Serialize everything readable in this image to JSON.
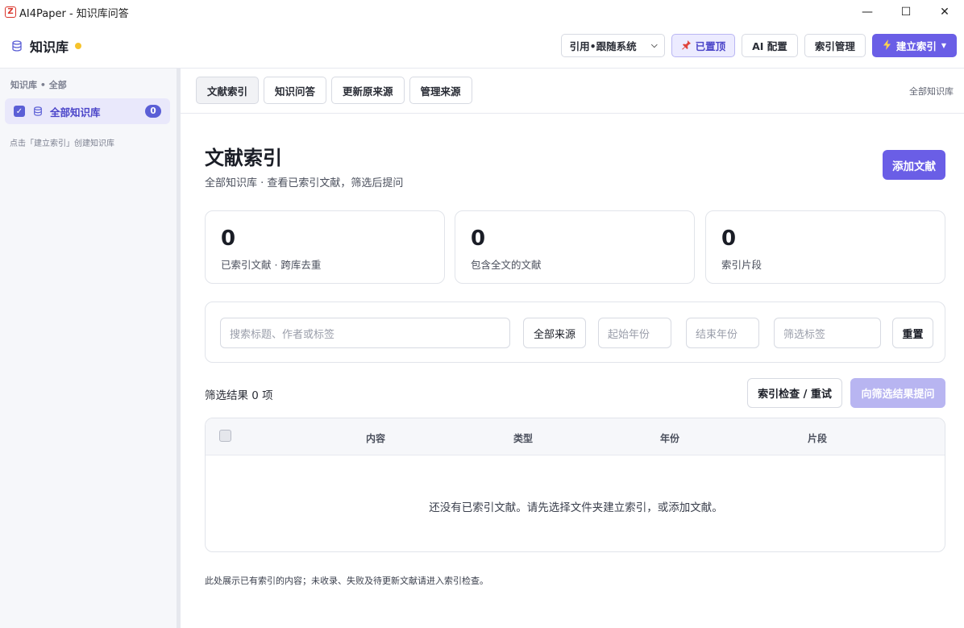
{
  "window": {
    "title": "AI4Paper - 知识库问答",
    "controls": {
      "minimize": "—",
      "maximize": "☐",
      "close": "✕"
    }
  },
  "header": {
    "title": "知识库",
    "status_dot_color": "#f6c32c",
    "mode_select": "引用•跟随系统",
    "pinned_label": "已置顶",
    "ai_config_label": "AI 配置",
    "index_manage_label": "索引管理",
    "build_index_label": "建立索引"
  },
  "sidebar": {
    "section_title": "知识库 • 全部",
    "items": [
      {
        "label": "全部知识库",
        "count": "0",
        "checked": true
      }
    ],
    "hint": "点击「建立索引」创建知识库"
  },
  "tabs": {
    "items": [
      {
        "label": "文献索引",
        "active": true
      },
      {
        "label": "知识问答",
        "active": false
      },
      {
        "label": "更新原来源",
        "active": false
      },
      {
        "label": "管理来源",
        "active": false
      }
    ],
    "scope": "全部知识库"
  },
  "main": {
    "title": "文献索引",
    "subtitle": "全部知识库 · 查看已索引文献，筛选后提问",
    "add_button": "添加文献",
    "stats": [
      {
        "value": "0",
        "label": "已索引文献 · 跨库去重"
      },
      {
        "value": "0",
        "label": "包含全文的文献"
      },
      {
        "value": "0",
        "label": "索引片段"
      }
    ],
    "filters": {
      "search_placeholder": "搜索标题、作者或标签",
      "source_button": "全部来源",
      "start_year_placeholder": "起始年份",
      "end_year_placeholder": "结束年份",
      "tag_placeholder": "筛选标签",
      "reset_button": "重置"
    },
    "result_count": "筛选结果 0 项",
    "check_button": "索引检查 / 重试",
    "ask_button": "向筛选结果提问",
    "table": {
      "columns": [
        "内容",
        "类型",
        "年份",
        "片段"
      ],
      "rows": [],
      "empty_message": "还没有已索引文献。请先选择文件夹建立索引，或添加文献。"
    },
    "footnote": "此处展示已有索引的内容；未收录、失败及待更新文献请进入索引检查。"
  },
  "colors": {
    "accent": "#6a5ee6",
    "accent_disabled": "#b8b5f1",
    "sidebar_active_bg": "#e9e8fb"
  }
}
